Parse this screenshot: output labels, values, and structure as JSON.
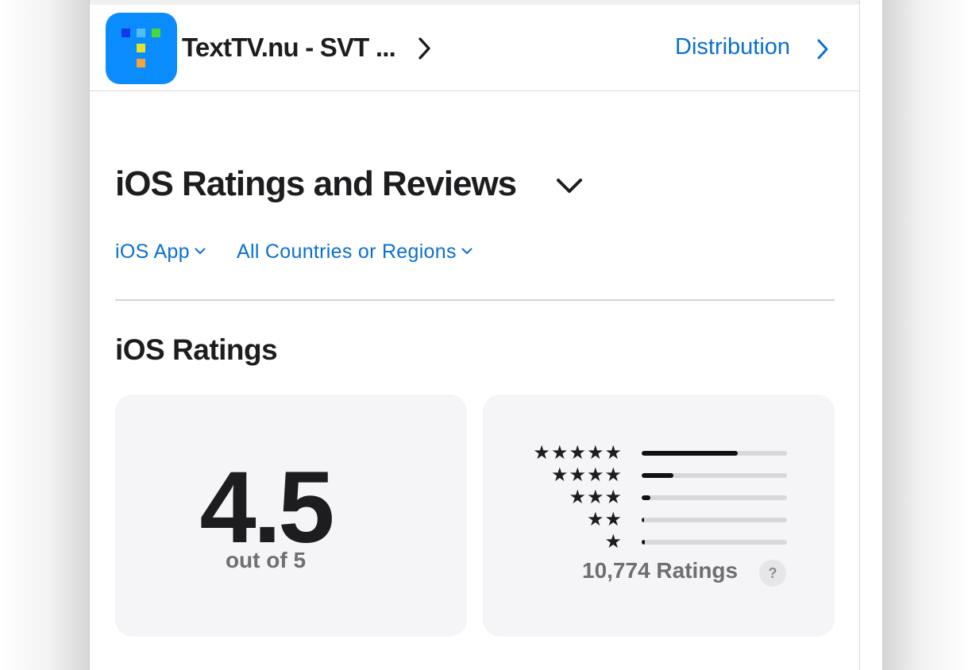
{
  "app": {
    "name": "TextTV.nu - SVT ...",
    "icon": "texttv-app-icon",
    "distribution_label": "Distribution"
  },
  "section": {
    "title": "iOS Ratings and Reviews"
  },
  "filters": {
    "platform": "iOS App",
    "region": "All Countries or Regions"
  },
  "ratings": {
    "title": "iOS Ratings",
    "average": "4.5",
    "out_of": "out of 5",
    "count_label": "10,774 Ratings",
    "help": "?",
    "distribution": [
      {
        "stars": "★★★★★",
        "fraction": 0.66
      },
      {
        "stars": "★★★★",
        "fraction": 0.22
      },
      {
        "stars": "★★★",
        "fraction": 0.06
      },
      {
        "stars": "★★",
        "fraction": 0.015
      },
      {
        "stars": "★",
        "fraction": 0.02
      }
    ]
  },
  "colors": {
    "accent": "#0a6fd0",
    "icon_bg": "#0a8cff",
    "bar_fill": "#111111",
    "bar_track": "#d8d8d8"
  }
}
